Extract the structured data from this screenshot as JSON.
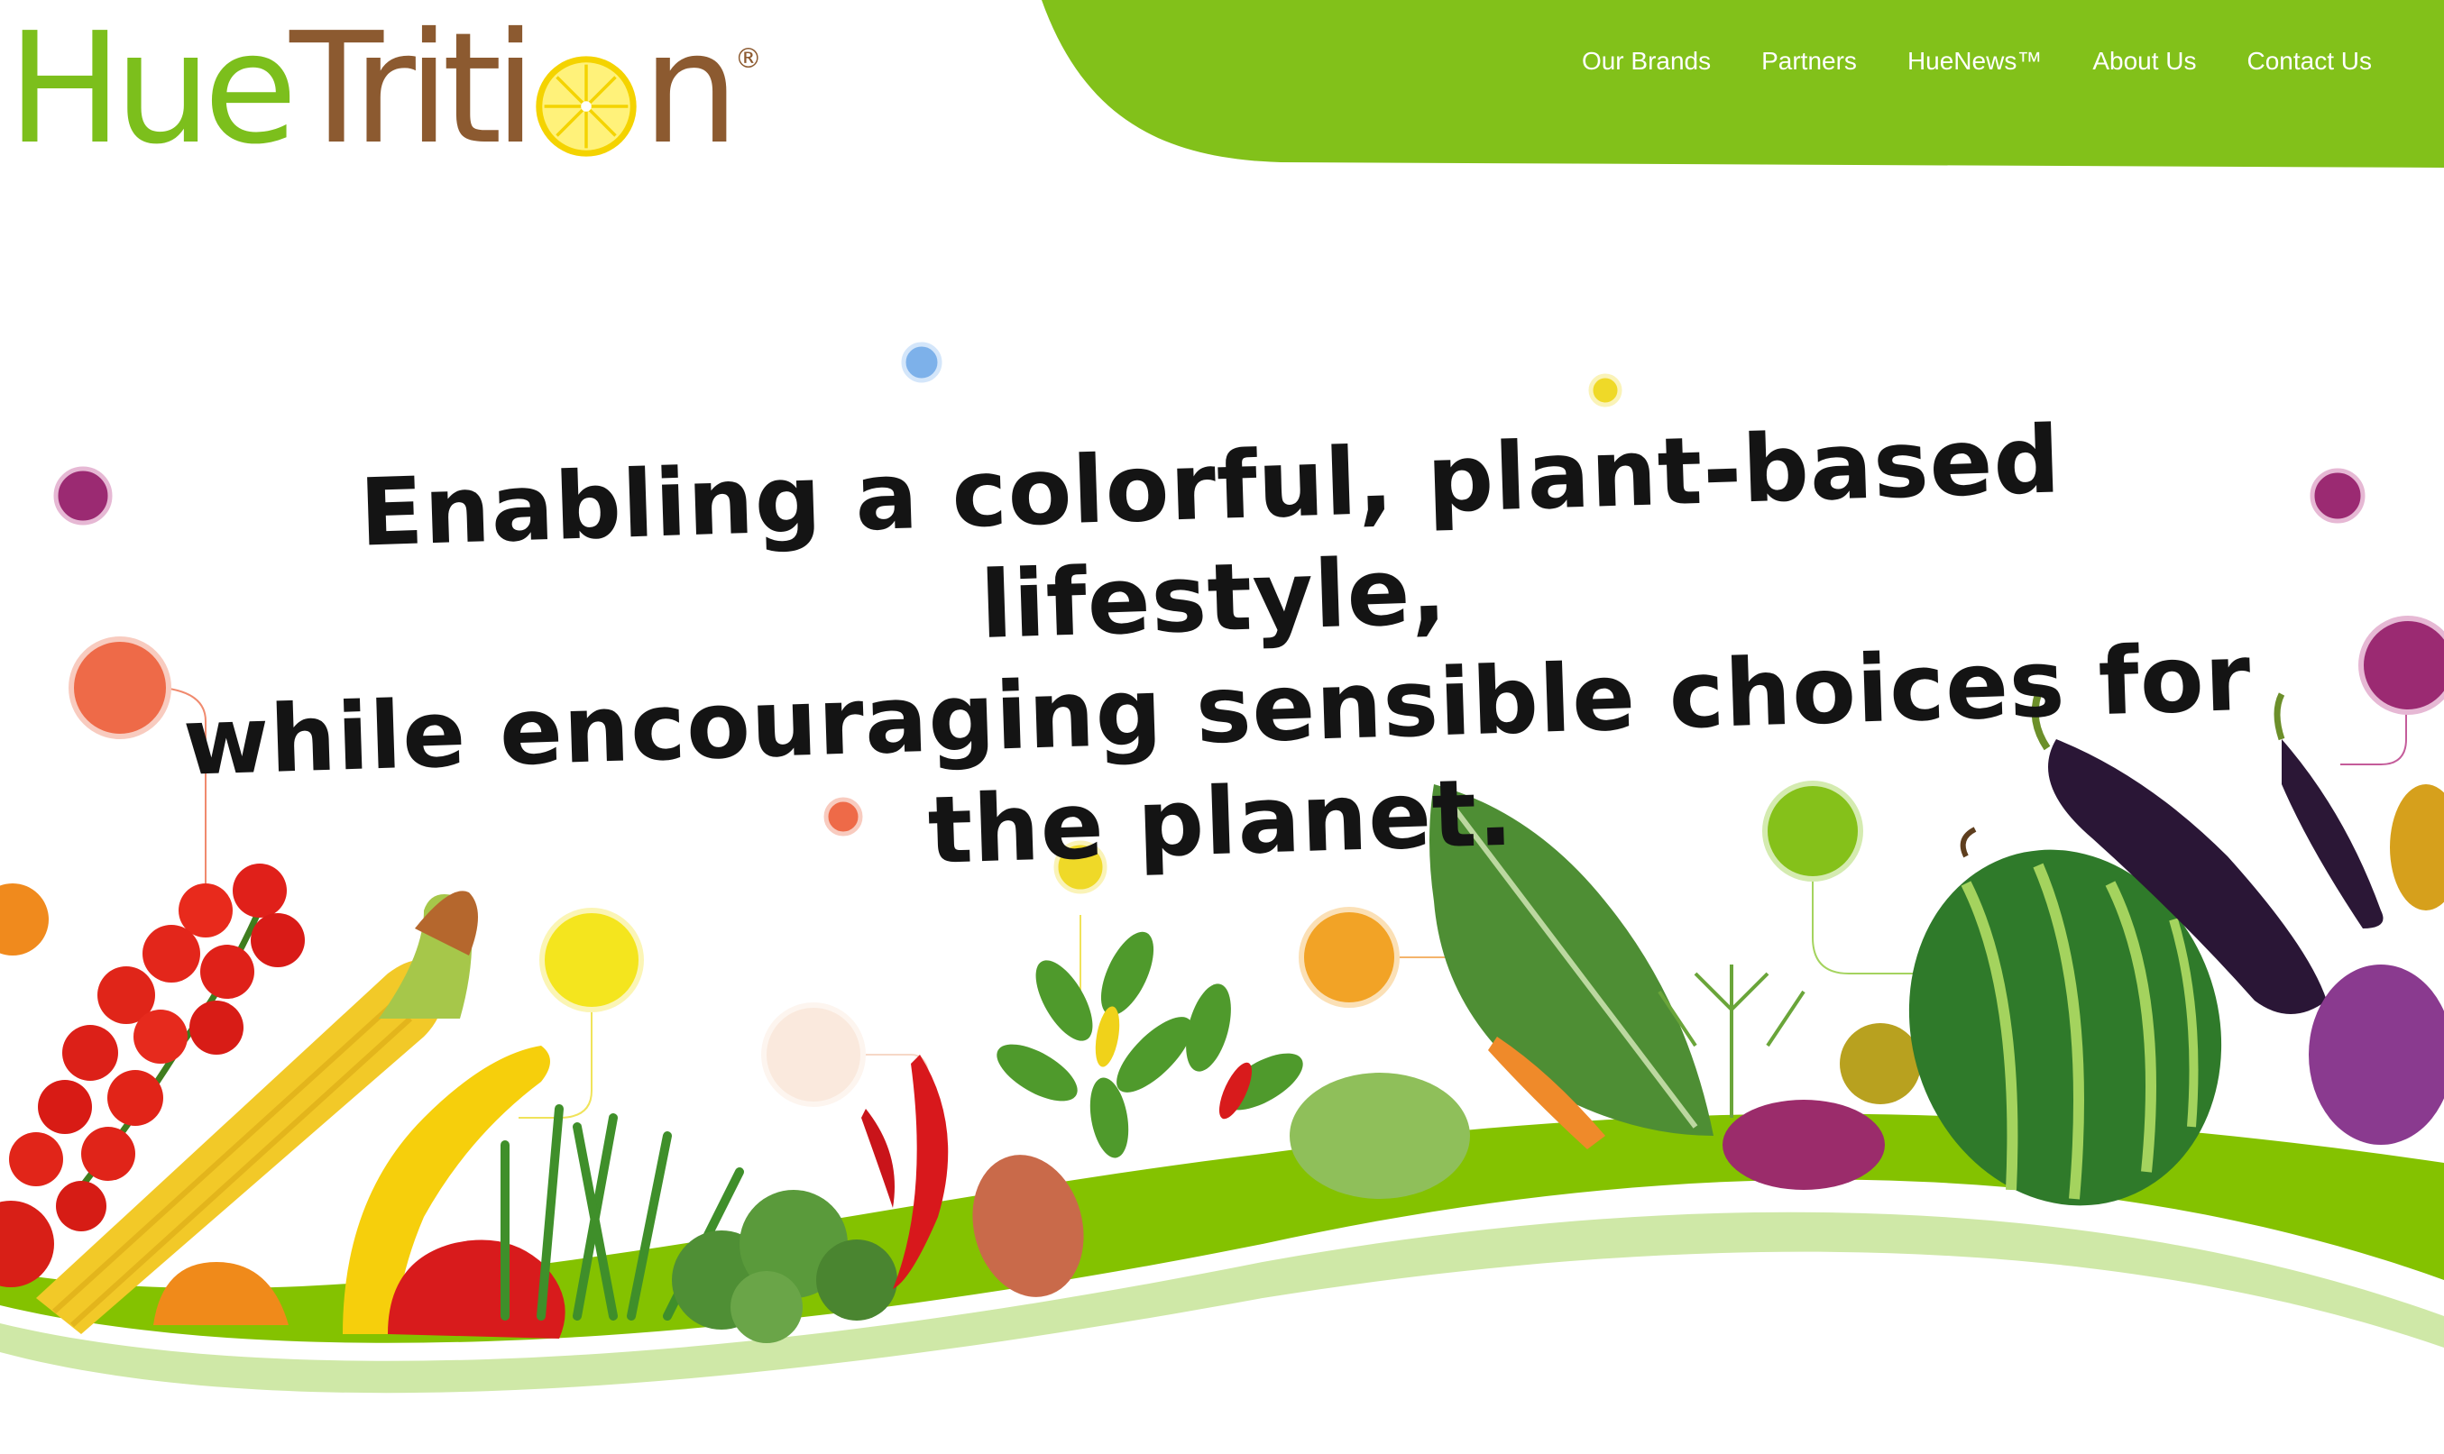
{
  "brand": {
    "name_part1": "Hue",
    "name_part2": "Triti",
    "name_part3": "n",
    "registered_mark": "®",
    "colors": {
      "green": "#7cbf1c",
      "brown": "#8c5a30",
      "lemon": "#f2dc1e"
    }
  },
  "nav": {
    "items": [
      {
        "label": "Our Brands"
      },
      {
        "label": "Partners"
      },
      {
        "label": "HueNews™"
      },
      {
        "label": "About Us"
      },
      {
        "label": "Contact Us"
      }
    ]
  },
  "hero": {
    "headline_lines": [
      "Enabling a colorful, plant-based lifestyle,",
      "while encouraging sensible choices for",
      "the planet."
    ],
    "accent_colors": [
      "#9b2a72",
      "#7db1ea",
      "#efd928",
      "#ee6a48",
      "#f2a326",
      "#85c11a",
      "#fae9dd",
      "#f4e51e"
    ]
  }
}
